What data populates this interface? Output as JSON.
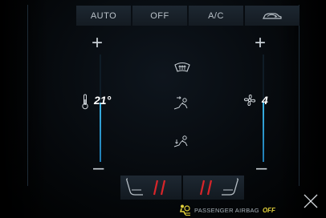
{
  "top_bar": {
    "auto_label": "AUTO",
    "off_label": "OFF",
    "ac_label": "A/C",
    "recirculation_icon": "car-recirculation-icon"
  },
  "temperature": {
    "value": "21°",
    "level_fraction": 0.55,
    "plus_symbol": "+",
    "minus_symbol": "–",
    "icon": "thermometer-icon",
    "accent_color": "#3ab4e6"
  },
  "fan": {
    "value": "4",
    "level_fraction": 0.55,
    "plus_symbol": "+",
    "minus_symbol": "–",
    "icon": "fan-icon"
  },
  "airflow_modes": [
    "windshield-defrost-icon",
    "airflow-face-icon",
    "airflow-feet-icon"
  ],
  "seats": {
    "left_icon": "seat-heater-left-icon",
    "right_icon": "seat-heater-right-icon",
    "heat_color": "#d8252a"
  },
  "airbag": {
    "label": "PASSENGER AIRBAG",
    "state": "OFF",
    "state_color": "#e3d23a",
    "icon": "airbag-off-icon"
  },
  "close_icon": "close-icon"
}
